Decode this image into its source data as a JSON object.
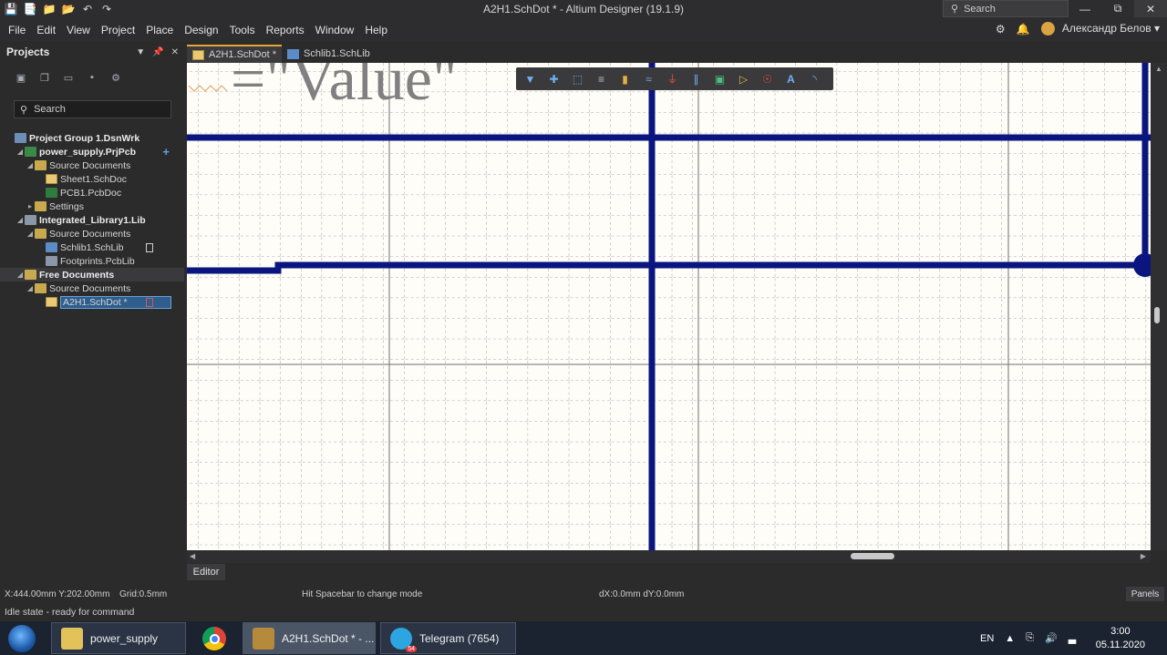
{
  "window": {
    "title": "A2H1.SchDot * - Altium Designer (19.1.9)",
    "search_placeholder": "Search"
  },
  "menu": [
    "File",
    "Edit",
    "View",
    "Project",
    "Place",
    "Design",
    "Tools",
    "Reports",
    "Window",
    "Help"
  ],
  "user": {
    "name": "Александр Белов"
  },
  "projects_panel": {
    "title": "Projects",
    "search_placeholder": "Search",
    "tree": [
      {
        "label": "Project Group 1.DsnWrk",
        "level": 0,
        "icon": "group-icon",
        "bold": true
      },
      {
        "label": "power_supply.PrjPcb",
        "level": 1,
        "icon": "project-icon",
        "bold": true
      },
      {
        "label": "Source Documents",
        "level": 2,
        "icon": "folder-icon"
      },
      {
        "label": "Sheet1.SchDoc",
        "level": 3,
        "icon": "schematic-icon"
      },
      {
        "label": "PCB1.PcbDoc",
        "level": 3,
        "icon": "pcb-icon"
      },
      {
        "label": "Settings",
        "level": 2,
        "icon": "folder-icon"
      },
      {
        "label": "Integrated_Library1.Lib",
        "level": 1,
        "icon": "library-icon",
        "bold": true
      },
      {
        "label": "Source Documents",
        "level": 2,
        "icon": "folder-icon"
      },
      {
        "label": "Schlib1.SchLib",
        "level": 3,
        "icon": "schlib-icon"
      },
      {
        "label": "Footprints.PcbLib",
        "level": 3,
        "icon": "pcblib-icon"
      },
      {
        "label": "Free Documents",
        "level": 1,
        "icon": "folder-icon",
        "bold": true
      },
      {
        "label": "Source Documents",
        "level": 2,
        "icon": "folder-icon"
      },
      {
        "label": "A2H1.SchDot *",
        "level": 3,
        "icon": "schematic-icon",
        "selected": true
      }
    ]
  },
  "doc_tabs": [
    {
      "label": "A2H1.SchDot *",
      "active": true
    },
    {
      "label": "Schlib1.SchLib",
      "active": false
    }
  ],
  "canvas": {
    "value_text": "=\"Value\""
  },
  "editor_tab": "Editor",
  "status": {
    "coords": "X:444.00mm Y:202.00mm",
    "grid": "Grid:0.5mm",
    "hint": "Hit Spacebar to change mode",
    "delta": "dX:0.0mm dY:0.0mm",
    "panels_button": "Panels",
    "state": "Idle state - ready for command"
  },
  "taskbar": {
    "items": [
      {
        "label": "power_supply"
      },
      {
        "label": "A2H1.SchDot * - ..."
      },
      {
        "label": "Telegram (7654)",
        "badge": "54"
      }
    ],
    "language": "EN",
    "time": "3:00",
    "date": "05.11.2020"
  },
  "colors": {
    "wire": "#0a1580",
    "canvas_bg": "#fffdf8",
    "accent": "#e8a53b"
  }
}
